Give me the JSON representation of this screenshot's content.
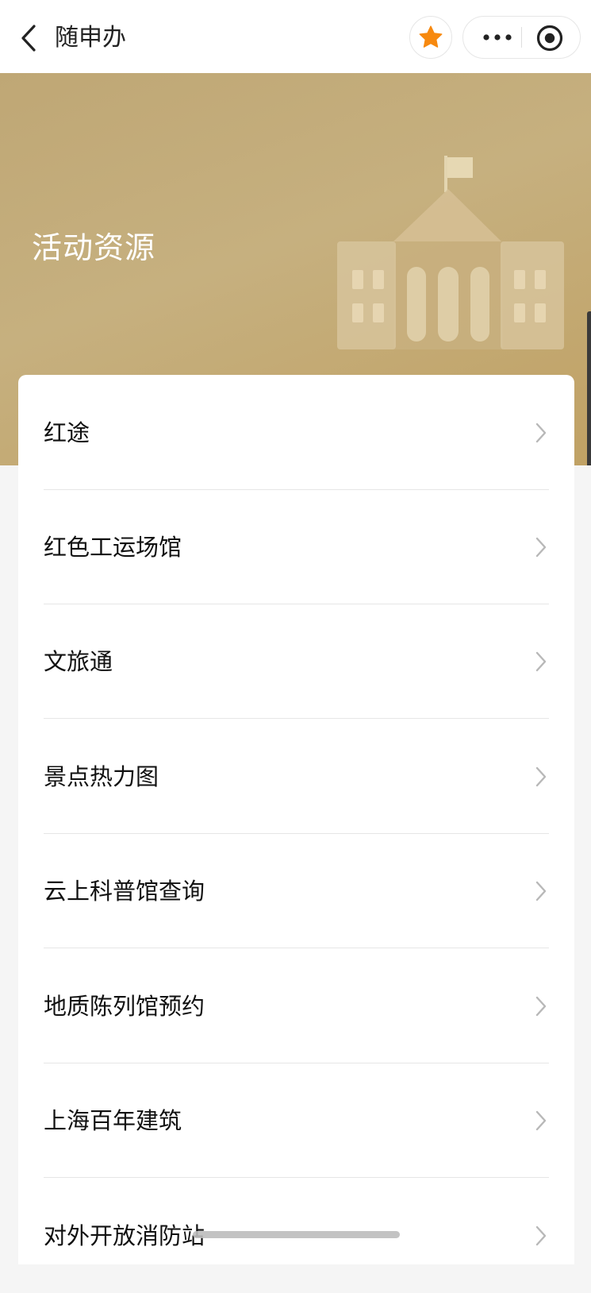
{
  "header": {
    "app_title": "随申办",
    "back_icon": "chevron-left-icon",
    "favorite_icon": "star-icon",
    "more_icon": "more-dots-icon",
    "close_icon": "record-circle-icon",
    "favorite_color": "#f7890f"
  },
  "banner": {
    "title": "活动资源",
    "illustration": "building-icon",
    "gradient_colors": [
      "#bfa775",
      "#c6b07f",
      "#c0a164"
    ]
  },
  "list": {
    "items": [
      {
        "label": "红途"
      },
      {
        "label": "红色工运场馆"
      },
      {
        "label": "文旅通"
      },
      {
        "label": "景点热力图"
      },
      {
        "label": "云上科普馆查询"
      },
      {
        "label": "地质陈列馆预约"
      },
      {
        "label": "上海百年建筑"
      },
      {
        "label": "对外开放消防站"
      }
    ],
    "chevron_icon": "chevron-right-icon"
  }
}
